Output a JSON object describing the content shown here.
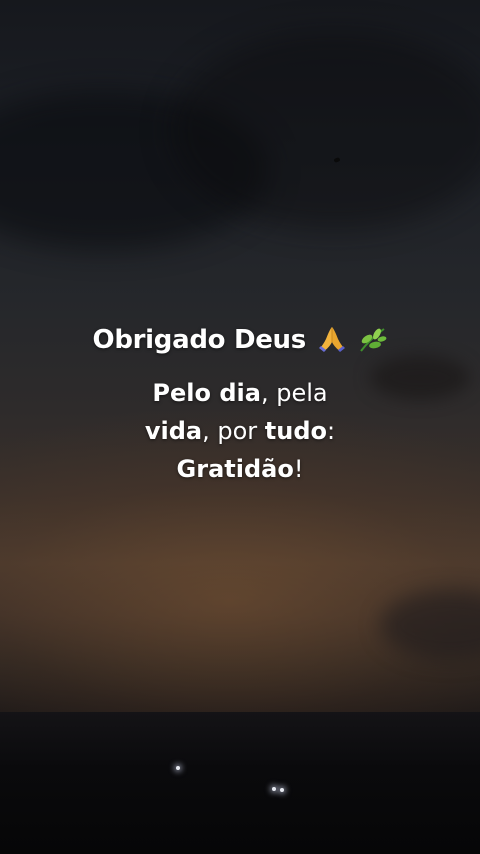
{
  "overlay_text": {
    "title": "Obrigado Deus",
    "title_emojis": [
      "folded-hands-icon",
      "herb-icon"
    ],
    "line1": {
      "bold_a": "Pelo dia",
      "normal_a": ", pela"
    },
    "line2": {
      "bold_a": "vida",
      "normal_a": ", por ",
      "bold_b": "tudo",
      "normal_b": ":"
    },
    "line3": {
      "bold_a": "Gratidão",
      "normal_a": "!"
    }
  },
  "colors": {
    "text": "#ffffff",
    "sky_top": "#16181d",
    "sunset_glow": "#4a3a2e",
    "ground": "#0a0a0c"
  }
}
